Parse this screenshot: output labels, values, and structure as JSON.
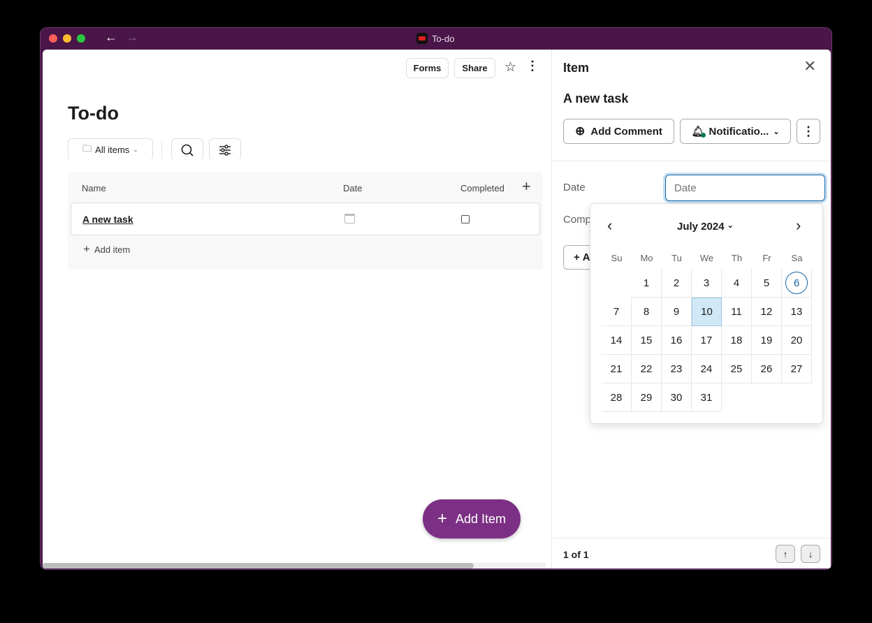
{
  "window": {
    "title": "To-do"
  },
  "toolbar": {
    "forms": "Forms",
    "share": "Share"
  },
  "page": {
    "title": "To-do",
    "view": "All items"
  },
  "table": {
    "columns": [
      "Name",
      "Date",
      "Completed"
    ],
    "rows": [
      {
        "name": "A new task",
        "completed": false
      }
    ],
    "add_item": "Add item"
  },
  "fab": {
    "label": "Add Item",
    "color": "#7c3085"
  },
  "panel": {
    "title": "Item",
    "item_name": "A new task",
    "add_comment": "Add Comment",
    "notifications": "Notificatio...",
    "date_label": "Date",
    "date_placeholder": "Date",
    "completed_label": "Comp",
    "add_label": "A",
    "pager": "1 of 1"
  },
  "calendar": {
    "month": "July 2024",
    "weekdays": [
      "Su",
      "Mo",
      "Tu",
      "We",
      "Th",
      "Fr",
      "Sa"
    ],
    "first_weekday": 1,
    "days": 31,
    "today": 6,
    "selected": 10,
    "accent": "#1264a3"
  }
}
